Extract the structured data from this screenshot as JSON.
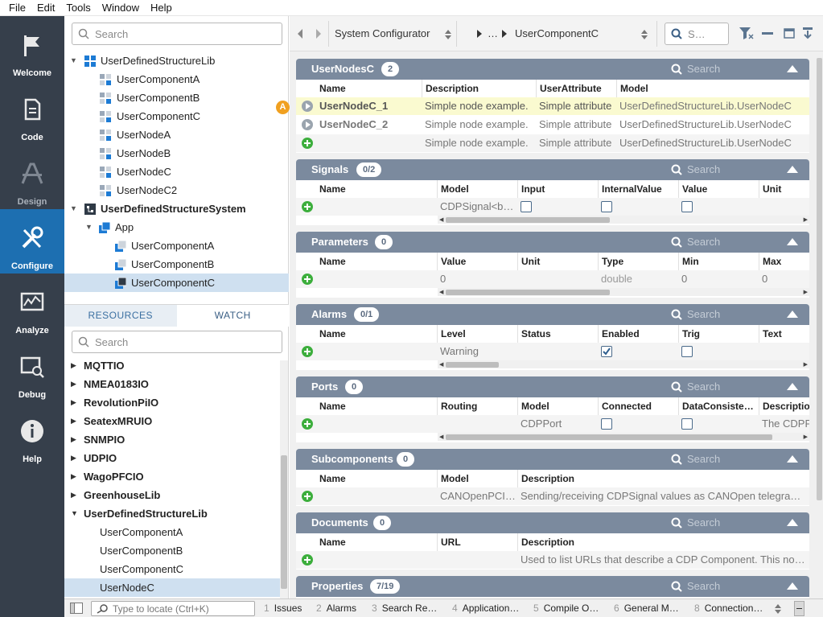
{
  "menu": {
    "file": "File",
    "edit": "Edit",
    "tools": "Tools",
    "window": "Window",
    "help": "Help"
  },
  "nav": [
    {
      "label": "Welcome"
    },
    {
      "label": "Code"
    },
    {
      "label": "Design"
    },
    {
      "label": "Configure"
    },
    {
      "label": "Analyze"
    },
    {
      "label": "Debug"
    },
    {
      "label": "Help"
    }
  ],
  "project_tree": {
    "search_placeholder": "Search",
    "items": [
      {
        "label": "UserDefinedStructureLib"
      },
      {
        "label": "UserComponentA"
      },
      {
        "label": "UserComponentB"
      },
      {
        "label": "UserComponentC"
      },
      {
        "label": "UserNodeA"
      },
      {
        "label": "UserNodeB"
      },
      {
        "label": "UserNodeC"
      },
      {
        "label": "UserNodeC2"
      },
      {
        "label": "UserDefinedStructureSystem"
      },
      {
        "label": "App"
      },
      {
        "label": "UserComponentA"
      },
      {
        "label": "UserComponentB"
      },
      {
        "label": "UserComponentC"
      }
    ]
  },
  "resource_tabs": {
    "resources": "RESOURCES",
    "watch": "WATCH"
  },
  "resources": {
    "search_placeholder": "Search",
    "items": [
      {
        "label": "MQTTIO"
      },
      {
        "label": "NMEA0183IO"
      },
      {
        "label": "RevolutionPiIO"
      },
      {
        "label": "SeatexMRUIO"
      },
      {
        "label": "SNMPIO"
      },
      {
        "label": "UDPIO"
      },
      {
        "label": "WagoPFCIO"
      },
      {
        "label": "GreenhouseLib"
      },
      {
        "label": "UserDefinedStructureLib"
      },
      {
        "label": "UserComponentA"
      },
      {
        "label": "UserComponentB"
      },
      {
        "label": "UserComponentC"
      },
      {
        "label": "UserNodeC"
      }
    ]
  },
  "toolbar": {
    "context": "System Configurator",
    "breadcrumb_ellipsis": "…",
    "breadcrumb_current": "UserComponentC",
    "search_placeholder": "S…"
  },
  "sections": {
    "usernodes": {
      "title": "UserNodesC",
      "count": "2",
      "search": "Search",
      "cols": {
        "name": "Name",
        "desc": "Description",
        "attr": "UserAttribute",
        "model": "Model"
      },
      "rows": [
        {
          "name": "UserNodeC_1",
          "desc": "Simple node example.",
          "attr": "Simple attribute",
          "model": "UserDefinedStructureLib.UserNodeC"
        },
        {
          "name": "UserNodeC_2",
          "desc": "Simple node example.",
          "attr": "Simple attribute",
          "model": "UserDefinedStructureLib.UserNodeC"
        },
        {
          "name": "",
          "desc": "Simple node example.",
          "attr": "Simple attribute",
          "model": "UserDefinedStructureLib.UserNodeC"
        }
      ]
    },
    "signals": {
      "title": "Signals",
      "count": "0/2",
      "search": "Search",
      "cols": {
        "name": "Name",
        "model": "Model",
        "input": "Input",
        "internal": "InternalValue",
        "value": "Value",
        "unit": "Unit"
      },
      "row": {
        "model": "CDPSignal<b…",
        "input": false,
        "internal": false,
        "value": false
      }
    },
    "parameters": {
      "title": "Parameters",
      "count": "0",
      "search": "Search",
      "cols": {
        "name": "Name",
        "value": "Value",
        "unit": "Unit",
        "type": "Type",
        "min": "Min",
        "max": "Max"
      },
      "row": {
        "value": "0",
        "type": "double",
        "min": "0",
        "max": "0"
      }
    },
    "alarms": {
      "title": "Alarms",
      "count": "0/1",
      "search": "Search",
      "cols": {
        "name": "Name",
        "level": "Level",
        "status": "Status",
        "enabled": "Enabled",
        "trig": "Trig",
        "text": "Text"
      },
      "row": {
        "level": "Warning",
        "enabled": true,
        "trig": false
      }
    },
    "ports": {
      "title": "Ports",
      "count": "0",
      "search": "Search",
      "cols": {
        "name": "Name",
        "routing": "Routing",
        "model": "Model",
        "connected": "Connected",
        "dc": "DataConsiste…",
        "desc": "Descriptio"
      },
      "row": {
        "model": "CDPPort",
        "connected": false,
        "dc": false,
        "desc": "The CDPP"
      }
    },
    "subcomponents": {
      "title": "Subcomponents",
      "count": "0",
      "search": "Search",
      "cols": {
        "name": "Name",
        "model": "Model",
        "desc": "Description"
      },
      "row": {
        "model": "CANOpenPCI…",
        "desc": "Sending/receiving CDPSignal values as CANOpen telegra…"
      }
    },
    "documents": {
      "title": "Documents",
      "count": "0",
      "search": "Search",
      "cols": {
        "name": "Name",
        "url": "URL",
        "desc": "Description"
      },
      "row": {
        "desc": "Used to list URLs that describe a CDP Component. This no…"
      }
    },
    "properties": {
      "title": "Properties",
      "count": "7/19",
      "search": "Search"
    }
  },
  "marker_label": "A",
  "statusbar": {
    "locate_placeholder": "Type to locate (Ctrl+K)",
    "tabs": [
      {
        "num": "1",
        "label": "Issues"
      },
      {
        "num": "2",
        "label": "Alarms"
      },
      {
        "num": "3",
        "label": "Search Re…"
      },
      {
        "num": "4",
        "label": "Application…"
      },
      {
        "num": "5",
        "label": "Compile O…"
      },
      {
        "num": "6",
        "label": "General M…"
      },
      {
        "num": "8",
        "label": "Connection…"
      }
    ]
  },
  "colors": {
    "nav_bg": "#363f4b",
    "nav_active": "#1d6fb1",
    "section_header": "#7b8a9e",
    "add_green": "#3cae3c",
    "marker": "#f0a020"
  }
}
